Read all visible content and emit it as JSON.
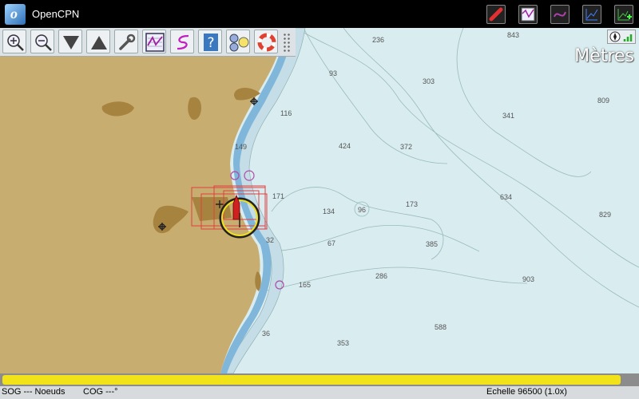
{
  "app": {
    "title": "OpenCPN",
    "logo_letter": "o"
  },
  "chart": {
    "units_label": "Mètres",
    "depths": [
      {
        "v": "236"
      },
      {
        "v": "843"
      },
      {
        "v": "93"
      },
      {
        "v": "303"
      },
      {
        "v": "809"
      },
      {
        "v": "116"
      },
      {
        "v": "341"
      },
      {
        "v": "424"
      },
      {
        "v": "372"
      },
      {
        "v": "149"
      },
      {
        "v": "171"
      },
      {
        "v": "634"
      },
      {
        "v": "134"
      },
      {
        "v": "96"
      },
      {
        "v": "173"
      },
      {
        "v": "829"
      },
      {
        "v": "32"
      },
      {
        "v": "67"
      },
      {
        "v": "385"
      },
      {
        "v": "286"
      },
      {
        "v": "903"
      },
      {
        "v": "165"
      },
      {
        "v": "588"
      },
      {
        "v": "36"
      },
      {
        "v": "353"
      }
    ]
  },
  "toolbar": {
    "tools": [
      {
        "name": "zoom-in"
      },
      {
        "name": "zoom-out"
      },
      {
        "name": "scale-down"
      },
      {
        "name": "scale-up"
      },
      {
        "name": "settings"
      },
      {
        "name": "route-manager"
      },
      {
        "name": "create-route"
      },
      {
        "name": "help"
      },
      {
        "name": "tide-current"
      },
      {
        "name": "man-overboard"
      }
    ]
  },
  "progress": {
    "fraction": 0.975
  },
  "status": {
    "sog": "SOG --- Noeuds",
    "cog": "COG ---°",
    "scale": "Echelle 96500 (1.0x)"
  },
  "colors": {
    "land": "#c8ad71",
    "sea": "#d9ecf0",
    "channel": "#7fb6d9",
    "progress": "#f2e21a"
  }
}
